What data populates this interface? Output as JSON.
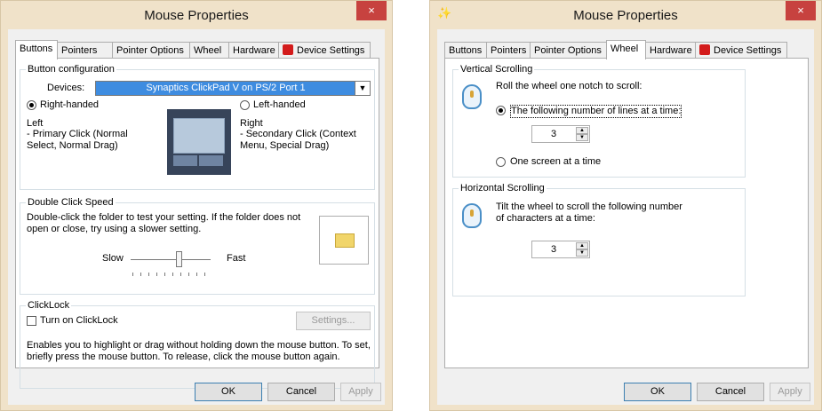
{
  "left": {
    "title": "Mouse Properties",
    "close": "×",
    "tabs": [
      "Buttons",
      "Pointers",
      "Pointer Options",
      "Wheel",
      "Hardware",
      "Device Settings"
    ],
    "button_config": {
      "label": "Button configuration",
      "devices_label": "Devices:",
      "devices_value": "Synaptics ClickPad V on PS/2 Port 1",
      "right_handed": "Right-handed",
      "left_handed": "Left-handed",
      "left_desc_title": "Left",
      "left_desc": "- Primary Click (Normal Select, Normal Drag)",
      "right_desc_title": "Right",
      "right_desc": "- Secondary Click (Context Menu, Special Drag)",
      "right_handed_selected": true
    },
    "double_click": {
      "label": "Double Click Speed",
      "desc": "Double-click the folder to test your setting.  If the folder does not open or close, try using a slower setting.",
      "slow": "Slow",
      "fast": "Fast",
      "speed_fraction": 0.6
    },
    "clicklock": {
      "label": "ClickLock",
      "checkbox": "Turn on ClickLock",
      "settings": "Settings...",
      "desc": "Enables you to highlight or drag without holding down the mouse button.  To set, briefly press the mouse button.  To release, click the mouse button again.",
      "checked": false
    },
    "buttons": {
      "ok": "OK",
      "cancel": "Cancel",
      "apply": "Apply"
    }
  },
  "right": {
    "title": "Mouse Properties",
    "close": "×",
    "tabs": [
      "Buttons",
      "Pointers",
      "Pointer Options",
      "Wheel",
      "Hardware",
      "Device Settings"
    ],
    "vertical": {
      "label": "Vertical Scrolling",
      "desc": "Roll the wheel one notch to scroll:",
      "lines_option": "The following number of lines at a time:",
      "lines_value": "3",
      "screen_option": "One screen at a time",
      "lines_selected": true
    },
    "horizontal": {
      "label": "Horizontal Scrolling",
      "desc": "Tilt the wheel to scroll the following number of characters at a time:",
      "chars_value": "3"
    },
    "buttons": {
      "ok": "OK",
      "cancel": "Cancel",
      "apply": "Apply"
    }
  },
  "colors": {
    "accent": "#3e8ce0",
    "close": "#c7423f",
    "frame": "#f0e2c9"
  }
}
